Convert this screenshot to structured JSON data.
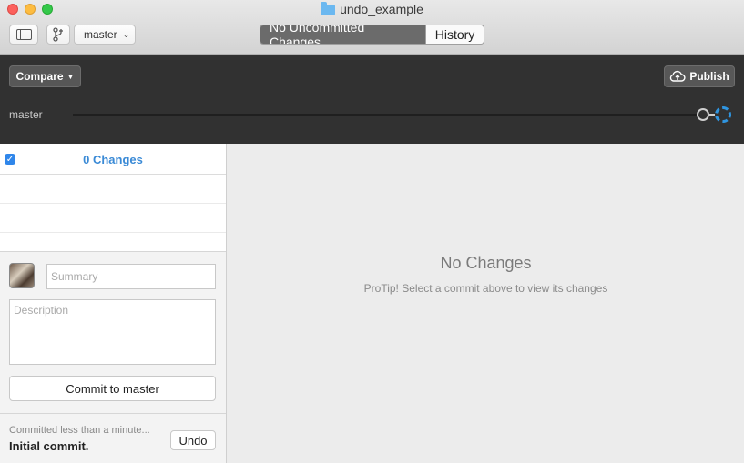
{
  "window": {
    "title": "undo_example"
  },
  "toolbar": {
    "branch": "master",
    "tabs": [
      {
        "label": "No Uncommitted Changes",
        "active": true
      },
      {
        "label": "History",
        "active": false
      }
    ]
  },
  "header": {
    "compare_label": "Compare",
    "publish_label": "Publish",
    "timeline_branch": "master"
  },
  "changes": {
    "count_label": "0 Changes",
    "all_selected": true
  },
  "commit": {
    "summary_placeholder": "Summary",
    "description_placeholder": "Description",
    "button_label": "Commit to master"
  },
  "last_commit": {
    "meta": "Committed less than a minute...",
    "title": "Initial commit.",
    "undo_label": "Undo"
  },
  "detail": {
    "empty_title": "No Changes",
    "empty_tip": "ProTip! Select a commit above to view its changes"
  },
  "colors": {
    "accent": "#3a8ad6",
    "pending_commit": "#2f95e0",
    "header_bg": "#313131"
  },
  "icons": [
    "folder-icon",
    "sidebar-toggle-icon",
    "branch-icon",
    "chevron-down-icon",
    "cloud-upload-icon",
    "checkbox-checked-icon"
  ]
}
